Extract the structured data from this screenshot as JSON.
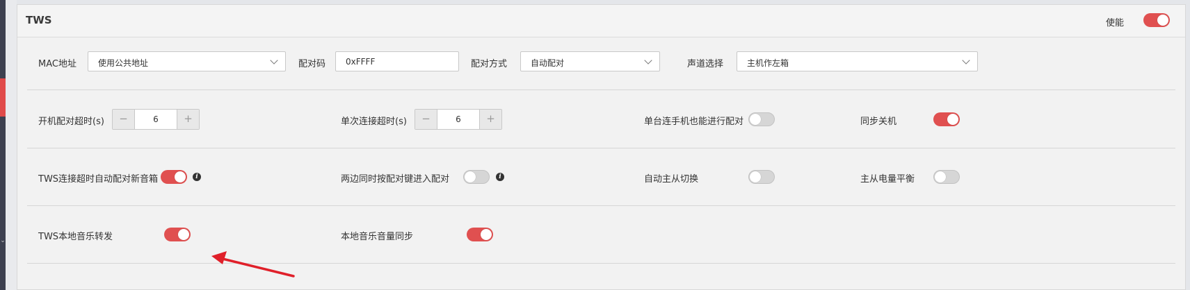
{
  "panel": {
    "title": "TWS",
    "enable_label": "使能",
    "enable_on": true
  },
  "row1": {
    "mac_label": "MAC地址",
    "mac_value": "使用公共地址",
    "pair_code_label": "配对码",
    "pair_code_value": "0xFFFF",
    "pair_mode_label": "配对方式",
    "pair_mode_value": "自动配对",
    "channel_label": "声道选择",
    "channel_value": "主机作左箱"
  },
  "row2": {
    "boot_timeout_label": "开机配对超时(s)",
    "boot_timeout_value": "6",
    "single_timeout_label": "单次连接超时(s)",
    "single_timeout_value": "6",
    "single_phone_pair_label": "单台连手机也能进行配对",
    "single_phone_pair_on": false,
    "sync_shutdown_label": "同步关机",
    "sync_shutdown_on": true
  },
  "row3": {
    "tws_timeout_auto_label": "TWS连接超时自动配对新音箱",
    "tws_timeout_auto_on": true,
    "both_press_pair_label": "两边同时按配对键进入配对",
    "both_press_pair_on": false,
    "auto_switch_label": "自动主从切换",
    "auto_switch_on": false,
    "battery_balance_label": "主从电量平衡",
    "battery_balance_on": false
  },
  "row4": {
    "local_music_label": "TWS本地音乐转发",
    "local_music_on": true,
    "local_volume_sync_label": "本地音乐音量同步",
    "local_volume_sync_on": true
  },
  "stepper": {
    "minus": "−",
    "plus": "+"
  },
  "info_glyph": "i",
  "colors": {
    "accent": "#e05050",
    "annotation_arrow": "#e0202a"
  },
  "icons": [
    "chevron-down-icon",
    "info-icon",
    "minus-icon",
    "plus-icon"
  ]
}
